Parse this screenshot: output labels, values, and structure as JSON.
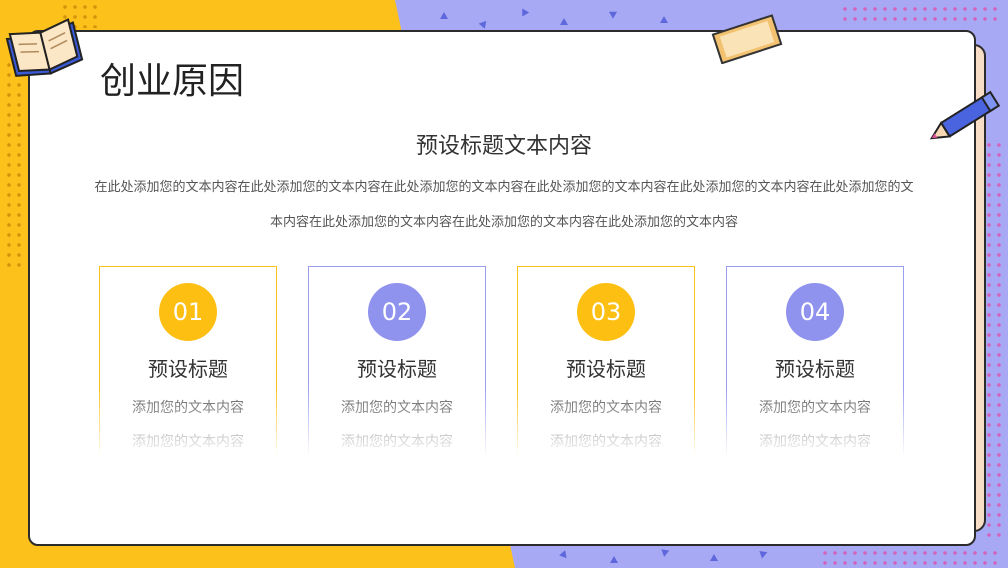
{
  "slide": {
    "title": "创业原因",
    "subtitle": "预设标题文本内容",
    "paragraph": "在此处添加您的文本内容在此处添加您的文本内容在此处添加您的文本内容在此处添加您的文本内容在此处添加您的文本内容在此处添加您的文本内容在此处添加您的文本内容在此处添加您的文本内容在此处添加您的文本内容"
  },
  "cards": [
    {
      "number": "01",
      "title": "预设标题",
      "line1": "添加您的文本内容",
      "line2": "添加您的文本内容",
      "accent": "#fcbf12"
    },
    {
      "number": "02",
      "title": "预设标题",
      "line1": "添加您的文本内容",
      "line2": "添加您的文本内容",
      "accent": "#8f93ee"
    },
    {
      "number": "03",
      "title": "预设标题",
      "line1": "添加您的文本内容",
      "line2": "添加您的文本内容",
      "accent": "#fcbf12"
    },
    {
      "number": "04",
      "title": "预设标题",
      "line1": "添加您的文本内容",
      "line2": "添加您的文本内容",
      "accent": "#8f93ee"
    }
  ],
  "colors": {
    "yellow": "#fcc11a",
    "periwinkle": "#a7a9f4",
    "card_bg": "#ffffff",
    "outline": "#2b2b2b"
  },
  "icons": [
    "open-book-icon",
    "notebook-icon",
    "pencil-icon"
  ]
}
